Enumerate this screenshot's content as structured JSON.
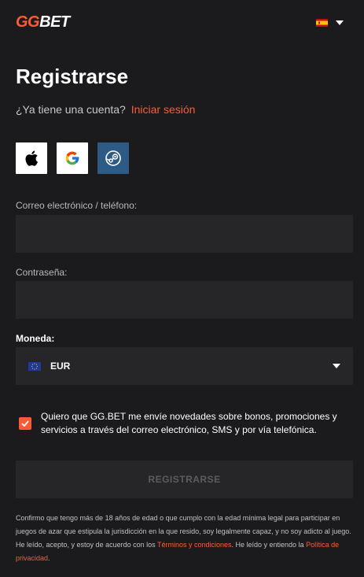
{
  "header": {
    "logo_gg": "GG",
    "logo_bet": "BET",
    "language_flag": "flag-es-icon"
  },
  "form": {
    "title": "Registrarse",
    "have_account_text": "¿Ya tiene una cuenta?",
    "login_link": "Iniciar sesión",
    "social": [
      "apple-icon",
      "google-icon",
      "steam-icon"
    ],
    "email_label": "Correo electrónico / teléfono:",
    "email_value": "",
    "email_placeholder": "",
    "password_label": "Contraseña:",
    "password_value": "",
    "password_placeholder": "",
    "currency_label": "Moneda:",
    "currency_value": "EUR",
    "newsletter_checked": true,
    "newsletter_text": "Quiero que GG.BET me envíe novedades sobre bonos, promociones y servicios a través del correo electrónico, SMS y por vía telefónica.",
    "submit_label": "REGISTRARSE",
    "legal_text_1": "Confirmo que tengo más de 18 años de edad o que cumplo con la edad mínima legal para participar en juegos de azar que estipula la jurisdicción en la que resido, soy legalmente capaz, y no soy adicto al juego. He leído, acepto, y estoy de acuerdo con los ",
    "terms_link": "Términos y condiciones",
    "legal_text_2": ". He leído y entiendo la ",
    "privacy_link": "Política de privacidad",
    "legal_text_3": "."
  },
  "colors": {
    "accent": "#ff5a36",
    "background": "#1b1b1d",
    "field": "#262628",
    "steam": "#2e5a86"
  }
}
